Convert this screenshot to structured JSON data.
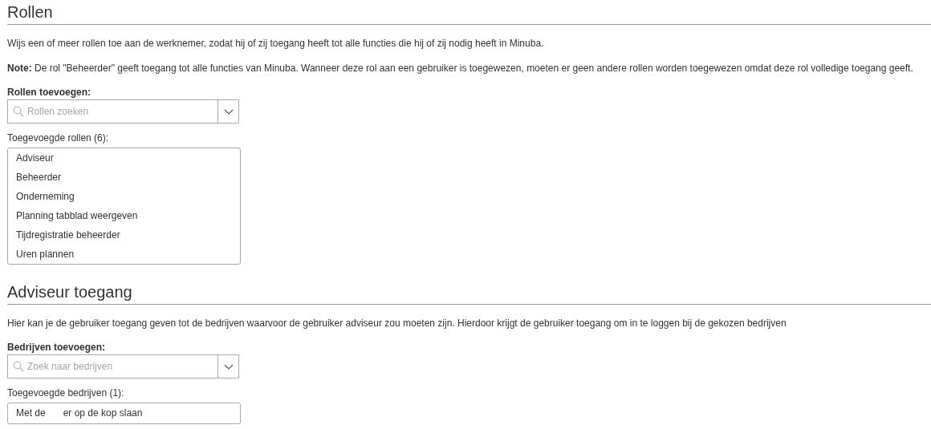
{
  "sections": [
    {
      "title": "Rollen",
      "paragraphs": [
        "Wijs een of meer rollen toe aan de werknemer, zodat hij of zij toegang heeft tot alle functies die hij of zij nodig heeft in Minuba.",
        "**Note:** De rol \"Beheerder\" geeft toegang tot alle functies van Minuba. Wanneer deze rol aan een gebruiker is toegewezen, moeten er geen andere rollen worden toegewezen omdat deze rol volledige toegang geeft."
      ],
      "add_label": "Rollen toevoegen:",
      "search": {
        "placeholder": "Rollen zoeken"
      },
      "list_label": "Toegevoegde rollen (6):",
      "items": [
        {
          "parts": [
            "Adviseur"
          ]
        },
        {
          "parts": [
            "Beheerder"
          ]
        },
        {
          "parts": [
            "Onderneming"
          ]
        },
        {
          "parts": [
            "Planning tabblad weergeven"
          ]
        },
        {
          "parts": [
            "Tijdregistratie beheerder"
          ]
        },
        {
          "parts": [
            "Uren plannen"
          ]
        }
      ]
    },
    {
      "title": "Adviseur toegang",
      "paragraphs": [
        "Hier kan je de gebruiker toegang geven tot de bedrijven waarvoor de gebruiker adviseur zou moeten zijn. Hierdoor krijgt de gebruiker toegang om in te loggen bij de gekozen bedrijven"
      ],
      "add_label": "Bedrijven toevoegen:",
      "search": {
        "placeholder": "Zoek naar bedrijven"
      },
      "list_label": "Toegevoegde bedrijven (1):",
      "items": [
        {
          "parts": [
            "Met de",
            "er op de kop slaan"
          ]
        }
      ]
    }
  ]
}
